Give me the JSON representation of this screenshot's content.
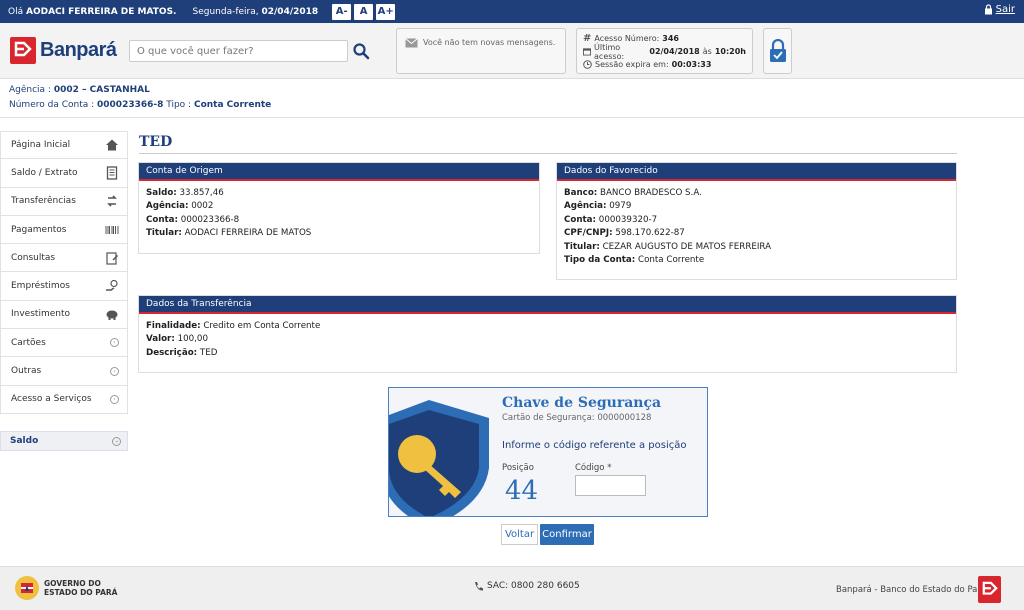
{
  "topbar": {
    "greeting_prefix": "Olá",
    "user_name": "AODACI FERREIRA DE MATOS.",
    "weekday": "Segunda-feira,",
    "date": "02/04/2018",
    "font_buttons": [
      "A-",
      "A",
      "A+"
    ],
    "exit_label": "Sair"
  },
  "header": {
    "logo_text": "Banpará",
    "search_placeholder": "O que você quer fazer?",
    "messages": "Você não tem novas mensagens.",
    "access": {
      "number_label": "Acesso Número:",
      "number_value": "346",
      "last_label": "Último acesso:",
      "last_date": "02/04/2018",
      "last_sep": "às",
      "last_time": "10:20h",
      "expires_label": "Sessão expira em:",
      "expires_value": "00:03:33"
    }
  },
  "account": {
    "agency_label": "Agência :",
    "agency_value": "0002 – CASTANHAL",
    "number_label": "Número da Conta :",
    "number_value": "000023366-8",
    "type_label": "Tipo :",
    "type_value": "Conta Corrente"
  },
  "sidebar": {
    "items": [
      {
        "label": "Página Inicial",
        "icon": "home-icon"
      },
      {
        "label": "Saldo / Extrato",
        "icon": "document-icon"
      },
      {
        "label": "Transferências",
        "icon": "transfer-icon"
      },
      {
        "label": "Pagamentos",
        "icon": "barcode-icon"
      },
      {
        "label": "Consultas",
        "icon": "clipboard-icon"
      },
      {
        "label": "Empréstimos",
        "icon": "hand-coin-icon"
      },
      {
        "label": "Investimento",
        "icon": "piggy-bank-icon"
      },
      {
        "label": "Cartões",
        "icon": "chevron-circle-icon"
      },
      {
        "label": "Outras",
        "icon": "chevron-circle-icon"
      },
      {
        "label": "Acesso a Serviços",
        "icon": "chevron-circle-icon"
      }
    ],
    "saldo_label": "Saldo"
  },
  "main": {
    "title": "TED",
    "origem": {
      "heading": "Conta de Origem",
      "saldo_label": "Saldo:",
      "saldo_value": "33.857,46",
      "agencia_label": "Agência:",
      "agencia_value": "0002",
      "conta_label": "Conta:",
      "conta_value": "000023366-8",
      "titular_label": "Titular:",
      "titular_value": "AODACI FERREIRA DE MATOS"
    },
    "favorecido": {
      "heading": "Dados do Favorecido",
      "banco_label": "Banco:",
      "banco_value": "BANCO BRADESCO S.A.",
      "agencia_label": "Agência:",
      "agencia_value": "0979",
      "conta_label": "Conta:",
      "conta_value": "000039320-7",
      "cpf_label": "CPF/CNPJ:",
      "cpf_value": "598.170.622-87",
      "titular_label": "Titular:",
      "titular_value": "CEZAR AUGUSTO DE MATOS FERREIRA",
      "tipo_label": "Tipo da Conta:",
      "tipo_value": "Conta Corrente"
    },
    "transferencia": {
      "heading": "Dados da Transferência",
      "finalidade_label": "Finalidade:",
      "finalidade_value": "Credito em Conta Corrente",
      "valor_label": "Valor:",
      "valor_value": "100,00",
      "descricao_label": "Descrição:",
      "descricao_value": "TED"
    },
    "security": {
      "title": "Chave de Segurança",
      "card_label": "Cartão de Segurança:",
      "card_value": "0000000128",
      "info": "Informe o código referente a posição",
      "position_label": "Posição",
      "position_value": "44",
      "code_label": "Código *",
      "code_value": ""
    },
    "buttons": {
      "back": "Voltar",
      "confirm": "Confirmar"
    }
  },
  "footer": {
    "gov_line1": "GOVERNO DO",
    "gov_line2": "ESTADO DO PARÁ",
    "sac": "SAC: 0800 280 6605",
    "bank": "Banpará - Banco do Estado do Pará"
  },
  "colors": {
    "brand_blue": "#1f3f7a",
    "brand_red": "#d9262e",
    "accent_blue": "#2d6db5"
  }
}
